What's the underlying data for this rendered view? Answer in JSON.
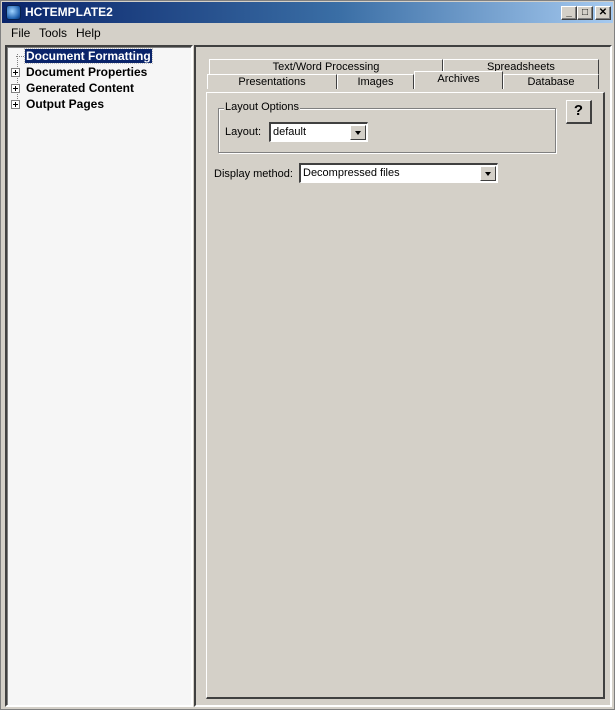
{
  "window": {
    "title": "HCTEMPLATE2",
    "controls": {
      "minimize": "_",
      "maximize": "□",
      "close": "✕"
    }
  },
  "menubar": {
    "items": [
      "File",
      "Tools",
      "Help"
    ]
  },
  "tree": {
    "items": [
      {
        "label": "Document Formatting",
        "selected": true,
        "expandable": false
      },
      {
        "label": "Document Properties",
        "selected": false,
        "expandable": true
      },
      {
        "label": "Generated Content",
        "selected": false,
        "expandable": true
      },
      {
        "label": "Output Pages",
        "selected": false,
        "expandable": true
      }
    ]
  },
  "tabs": {
    "row1": [
      "Text/Word Processing",
      "Spreadsheets"
    ],
    "row2": [
      "Presentations",
      "Images",
      "Archives",
      "Database"
    ],
    "active": "Archives"
  },
  "archives": {
    "group_title": "Layout Options",
    "layout_label": "Layout:",
    "layout_value": "default",
    "display_method_label": "Display method:",
    "display_method_value": "Decompressed files",
    "help_label": "?"
  }
}
